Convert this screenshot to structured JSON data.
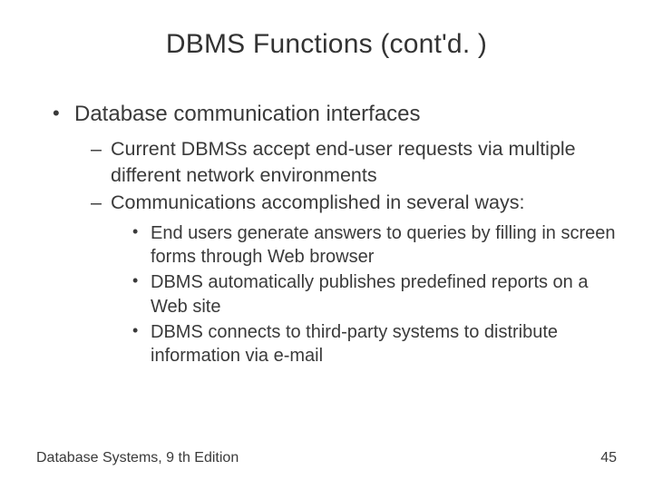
{
  "title": "DBMS Functions (cont'd. )",
  "bullets": {
    "l1": {
      "item0": "Database communication interfaces"
    },
    "l2": {
      "item0": "Current DBMSs accept end-user requests via multiple different network environments",
      "item1": "Communications accomplished in several ways:"
    },
    "l3": {
      "item0": "End users generate answers to queries by filling in screen forms through Web browser",
      "item1": "DBMS automatically publishes predefined reports on a Web site",
      "item2": "DBMS connects to third-party systems to distribute information via e-mail"
    }
  },
  "footer": {
    "left": "Database Systems, 9 th Edition",
    "right": "45"
  }
}
